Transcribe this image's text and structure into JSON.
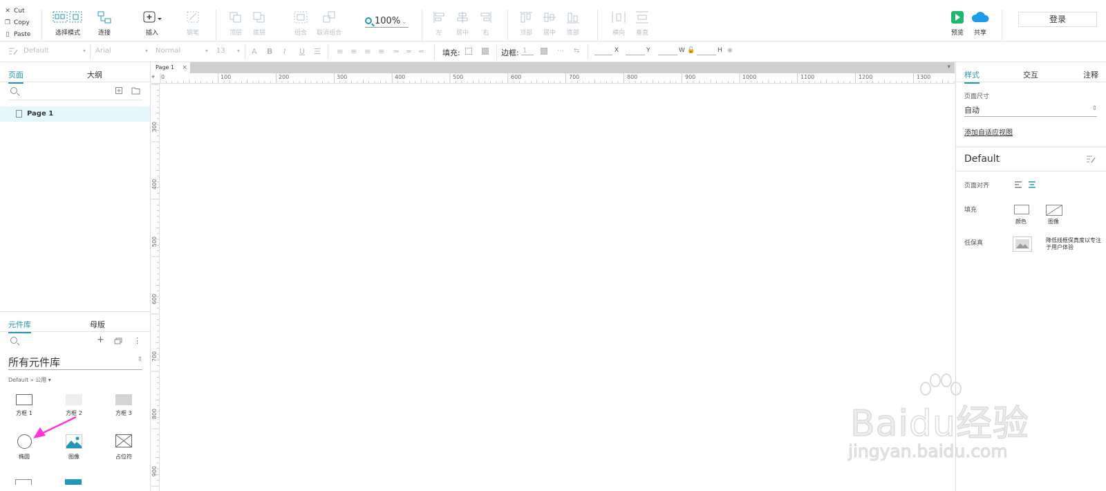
{
  "clipboard": {
    "cut": "Cut",
    "copy": "Copy",
    "paste": "Paste"
  },
  "toolbar": {
    "select_mode": "选择模式",
    "connect": "连接",
    "insert": "插入",
    "point": "钢笔",
    "top_layer": "顶层",
    "bottom_layer": "底层",
    "group": "组合",
    "ungroup": "取消组合",
    "zoom": "100%",
    "align_left": "左",
    "align_center": "居中",
    "align_right": "右",
    "align_top": "顶部",
    "align_middle": "居中",
    "align_bottom": "底部",
    "distribute_h": "横向",
    "distribute_v": "垂直",
    "preview": "预览",
    "share": "共享",
    "login": "登录"
  },
  "formatbar": {
    "style": "Default",
    "font": "Arial",
    "weight": "Normal",
    "size": "13",
    "fill_label": "填充:",
    "border_label": "边框:",
    "border_width": "1",
    "x": "X",
    "y": "Y",
    "w": "W",
    "h": "H"
  },
  "pages_panel": {
    "tab_pages": "页面",
    "tab_outline": "大纲",
    "page1": "Page 1"
  },
  "library_panel": {
    "tab_library": "元件库",
    "tab_masters": "母版",
    "library_select": "所有元件库",
    "breadcrumb": "Default » 公用 ▾",
    "widgets": [
      "方框 1",
      "方框 2",
      "方框 3",
      "椭圆",
      "图像",
      "占位符"
    ]
  },
  "canvas": {
    "tab": "Page 1",
    "hruler": [
      "0",
      "100",
      "200",
      "300",
      "400",
      "500",
      "600",
      "700",
      "800",
      "900",
      "1000",
      "1100",
      "1200",
      "1300"
    ],
    "vruler": [
      "300",
      "400",
      "500",
      "600",
      "700",
      "800",
      "900"
    ]
  },
  "right_panel": {
    "tab_style": "样式",
    "tab_interact": "交互",
    "tab_notes": "注释",
    "page_size_label": "页面尺寸",
    "page_size_value": "自动",
    "add_adaptive": "添加自适应视图",
    "style_name": "Default",
    "page_align_label": "页面对齐",
    "fill_label": "填充",
    "fill_color": "颜色",
    "fill_image": "图像",
    "low_fidelity_label": "低保真",
    "low_fidelity_desc_1": "降低线框保真度以专注",
    "low_fidelity_desc_2": "于用户体验"
  },
  "watermark": {
    "logo": "Baidu经验",
    "sub": "jingyan.baidu.com"
  },
  "colors": {
    "accent": "#2196b8",
    "selected_row": "#e6f7fb",
    "annotation_arrow": "#ff33dd"
  }
}
